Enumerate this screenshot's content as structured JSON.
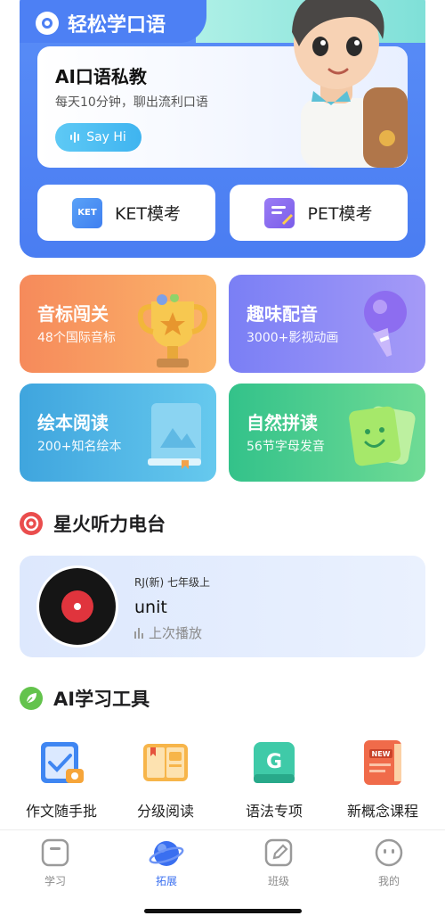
{
  "hero": {
    "title": "轻松学口语",
    "ai_card": {
      "title": "AI口语私教",
      "subtitle": "每天10分钟，聊出流利口语",
      "button": "Say Hi"
    },
    "exams": [
      {
        "label": "KET模考",
        "icon": "ket-icon",
        "icon_text": "KET"
      },
      {
        "label": "PET模考",
        "icon": "pet-icon"
      }
    ]
  },
  "features": [
    {
      "title": "音标闯关",
      "subtitle": "48个国际音标",
      "icon": "trophy-icon"
    },
    {
      "title": "趣味配音",
      "subtitle": "3000+影视动画",
      "icon": "microphone-icon"
    },
    {
      "title": "绘本阅读",
      "subtitle": "200+知名绘本",
      "icon": "picture-book-icon"
    },
    {
      "title": "自然拼读",
      "subtitle": "56节字母发音",
      "icon": "letter-cards-icon"
    }
  ],
  "radio": {
    "section_title": "星火听力电台",
    "book": "RJ(新) 七年级上",
    "unit": "unit",
    "last_play": "上次播放"
  },
  "tools": {
    "section_title": "AI学习工具",
    "items": [
      {
        "label": "作文随手批",
        "icon": "essay-check-icon"
      },
      {
        "label": "分级阅读",
        "icon": "graded-reading-icon"
      },
      {
        "label": "语法专项",
        "icon": "grammar-icon",
        "icon_text": "G"
      },
      {
        "label": "新概念课程",
        "icon": "new-concept-icon",
        "icon_text": "NEW"
      }
    ]
  },
  "nav": [
    {
      "label": "学习",
      "icon": "study-icon",
      "active": false
    },
    {
      "label": "拓展",
      "icon": "planet-icon",
      "active": true
    },
    {
      "label": "班级",
      "icon": "class-edit-icon",
      "active": false
    },
    {
      "label": "我的",
      "icon": "profile-face-icon",
      "active": false
    }
  ],
  "colors": {
    "hero_blue": "#4a7df2",
    "accent_blue": "#3a6ff0",
    "orange_tile": "#f68a5b",
    "purple_tile": "#7a7ff5",
    "blue_tile": "#3fa5de",
    "green_tile": "#33c28a",
    "radio_red": "#e0343d"
  }
}
